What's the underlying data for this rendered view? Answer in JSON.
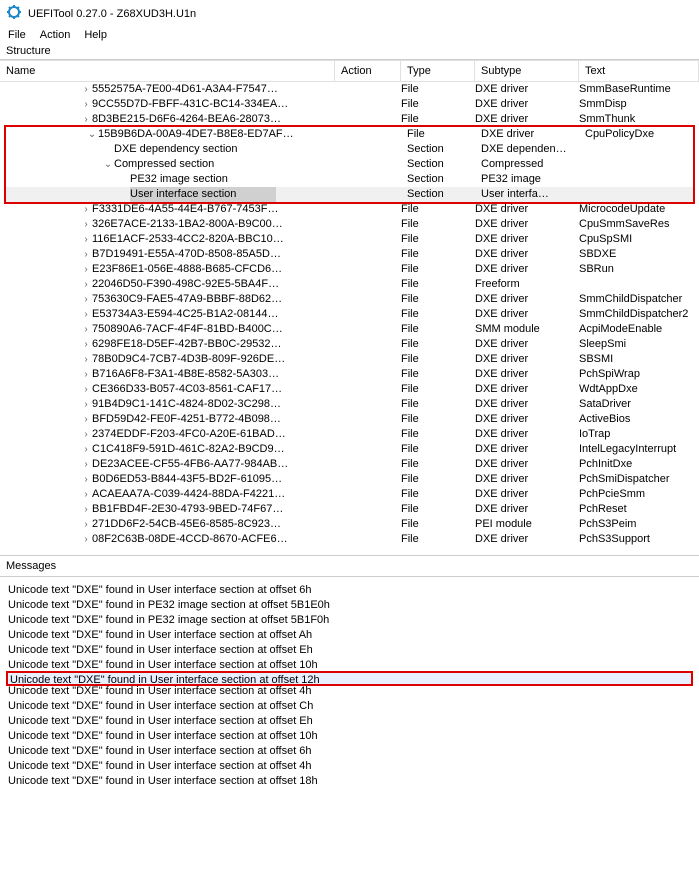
{
  "window": {
    "title": "UEFITool 0.27.0 - Z68XUD3H.U1n"
  },
  "menu": {
    "file": "File",
    "action": "Action",
    "help": "Help"
  },
  "sections": {
    "structure": "Structure",
    "messages": "Messages"
  },
  "columns": {
    "name": "Name",
    "action": "Action",
    "type": "Type",
    "subtype": "Subtype",
    "text": "Text"
  },
  "rows": [
    {
      "indent": 80,
      "chev": ">",
      "name": "5552575A-7E00-4D61-A3A4-F7547…",
      "type": "File",
      "subtype": "DXE driver",
      "text": "SmmBaseRuntime"
    },
    {
      "indent": 80,
      "chev": ">",
      "name": "9CC55D7D-FBFF-431C-BC14-334EA…",
      "type": "File",
      "subtype": "DXE driver",
      "text": "SmmDisp"
    },
    {
      "indent": 80,
      "chev": ">",
      "name": "8D3BE215-D6F6-4264-BEA6-28073…",
      "type": "File",
      "subtype": "DXE driver",
      "text": "SmmThunk"
    },
    {
      "indent": 80,
      "chev": "v",
      "name": "15B9B6DA-00A9-4DE7-B8E8-ED7AF…",
      "type": "File",
      "subtype": "DXE driver",
      "text": "CpuPolicyDxe",
      "boxstart": true
    },
    {
      "indent": 96,
      "chev": "",
      "name": "DXE dependency section",
      "type": "Section",
      "subtype": "DXE dependen…",
      "text": ""
    },
    {
      "indent": 96,
      "chev": "v",
      "name": "Compressed section",
      "type": "Section",
      "subtype": "Compressed",
      "text": ""
    },
    {
      "indent": 112,
      "chev": "",
      "name": "PE32 image section",
      "type": "Section",
      "subtype": "PE32 image",
      "text": ""
    },
    {
      "indent": 112,
      "chev": "",
      "name": "User interface section",
      "type": "Section",
      "subtype": "User interfa…",
      "text": "",
      "selected": true,
      "boxend": true
    },
    {
      "indent": 80,
      "chev": ">",
      "name": "F3331DE6-4A55-44E4-B767-7453F…",
      "type": "File",
      "subtype": "DXE driver",
      "text": "MicrocodeUpdate"
    },
    {
      "indent": 80,
      "chev": ">",
      "name": "326E7ACE-2133-1BA2-800A-B9C00…",
      "type": "File",
      "subtype": "DXE driver",
      "text": "CpuSmmSaveRes"
    },
    {
      "indent": 80,
      "chev": ">",
      "name": "116E1ACF-2533-4CC2-820A-BBC10…",
      "type": "File",
      "subtype": "DXE driver",
      "text": "CpuSpSMI"
    },
    {
      "indent": 80,
      "chev": ">",
      "name": "B7D19491-E55A-470D-8508-85A5D…",
      "type": "File",
      "subtype": "DXE driver",
      "text": "SBDXE"
    },
    {
      "indent": 80,
      "chev": ">",
      "name": "E23F86E1-056E-4888-B685-CFCD6…",
      "type": "File",
      "subtype": "DXE driver",
      "text": "SBRun"
    },
    {
      "indent": 80,
      "chev": ">",
      "name": "22046D50-F390-498C-92E5-5BA4F…",
      "type": "File",
      "subtype": "Freeform",
      "text": ""
    },
    {
      "indent": 80,
      "chev": ">",
      "name": "753630C9-FAE5-47A9-BBBF-88D62…",
      "type": "File",
      "subtype": "DXE driver",
      "text": "SmmChildDispatcher"
    },
    {
      "indent": 80,
      "chev": ">",
      "name": "E53734A3-E594-4C25-B1A2-08144…",
      "type": "File",
      "subtype": "DXE driver",
      "text": "SmmChildDispatcher2"
    },
    {
      "indent": 80,
      "chev": ">",
      "name": "750890A6-7ACF-4F4F-81BD-B400C…",
      "type": "File",
      "subtype": "SMM module",
      "text": "AcpiModeEnable"
    },
    {
      "indent": 80,
      "chev": ">",
      "name": "6298FE18-D5EF-42B7-BB0C-29532…",
      "type": "File",
      "subtype": "DXE driver",
      "text": "SleepSmi"
    },
    {
      "indent": 80,
      "chev": ">",
      "name": "78B0D9C4-7CB7-4D3B-809F-926DE…",
      "type": "File",
      "subtype": "DXE driver",
      "text": "SBSMI"
    },
    {
      "indent": 80,
      "chev": ">",
      "name": "B716A6F8-F3A1-4B8E-8582-5A303…",
      "type": "File",
      "subtype": "DXE driver",
      "text": "PchSpiWrap"
    },
    {
      "indent": 80,
      "chev": ">",
      "name": "CE366D33-B057-4C03-8561-CAF17…",
      "type": "File",
      "subtype": "DXE driver",
      "text": "WdtAppDxe"
    },
    {
      "indent": 80,
      "chev": ">",
      "name": "91B4D9C1-141C-4824-8D02-3C298…",
      "type": "File",
      "subtype": "DXE driver",
      "text": "SataDriver"
    },
    {
      "indent": 80,
      "chev": ">",
      "name": "BFD59D42-FE0F-4251-B772-4B098…",
      "type": "File",
      "subtype": "DXE driver",
      "text": "ActiveBios"
    },
    {
      "indent": 80,
      "chev": ">",
      "name": "2374EDDF-F203-4FC0-A20E-61BAD…",
      "type": "File",
      "subtype": "DXE driver",
      "text": "IoTrap"
    },
    {
      "indent": 80,
      "chev": ">",
      "name": "C1C418F9-591D-461C-82A2-B9CD9…",
      "type": "File",
      "subtype": "DXE driver",
      "text": "IntelLegacyInterrupt"
    },
    {
      "indent": 80,
      "chev": ">",
      "name": "DE23ACEE-CF55-4FB6-AA77-984AB…",
      "type": "File",
      "subtype": "DXE driver",
      "text": "PchInitDxe"
    },
    {
      "indent": 80,
      "chev": ">",
      "name": "B0D6ED53-B844-43F5-BD2F-61095…",
      "type": "File",
      "subtype": "DXE driver",
      "text": "PchSmiDispatcher"
    },
    {
      "indent": 80,
      "chev": ">",
      "name": "ACAEAA7A-C039-4424-88DA-F4221…",
      "type": "File",
      "subtype": "DXE driver",
      "text": "PchPcieSmm"
    },
    {
      "indent": 80,
      "chev": ">",
      "name": "BB1FBD4F-2E30-4793-9BED-74F67…",
      "type": "File",
      "subtype": "DXE driver",
      "text": "PchReset"
    },
    {
      "indent": 80,
      "chev": ">",
      "name": "271DD6F2-54CB-45E6-8585-8C923…",
      "type": "File",
      "subtype": "PEI module",
      "text": "PchS3Peim"
    },
    {
      "indent": 80,
      "chev": ">",
      "name": "08F2C63B-08DE-4CCD-8670-ACFE6…",
      "type": "File",
      "subtype": "DXE driver",
      "text": "PchS3Support"
    }
  ],
  "messages_list": [
    {
      "text": "Unicode text \"DXE\" found in User interface section at offset 6h"
    },
    {
      "text": "Unicode text \"DXE\" found in PE32 image section at offset 5B1E0h"
    },
    {
      "text": "Unicode text \"DXE\" found in PE32 image section at offset 5B1F0h"
    },
    {
      "text": "Unicode text \"DXE\" found in User interface section at offset Ah"
    },
    {
      "text": "Unicode text \"DXE\" found in User interface section at offset Eh"
    },
    {
      "text": "Unicode text \"DXE\" found in User interface section at offset 10h"
    },
    {
      "text": "Unicode text \"DXE\" found in User interface section at offset 12h",
      "hl": true
    },
    {
      "text": "Unicode text \"DXE\" found in User interface section at offset 4h"
    },
    {
      "text": "Unicode text \"DXE\" found in User interface section at offset Ch"
    },
    {
      "text": "Unicode text \"DXE\" found in User interface section at offset Eh"
    },
    {
      "text": "Unicode text \"DXE\" found in User interface section at offset 10h"
    },
    {
      "text": "Unicode text \"DXE\" found in User interface section at offset 6h"
    },
    {
      "text": "Unicode text \"DXE\" found in User interface section at offset 4h"
    },
    {
      "text": "Unicode text \"DXE\" found in User interface section at offset 18h"
    }
  ]
}
